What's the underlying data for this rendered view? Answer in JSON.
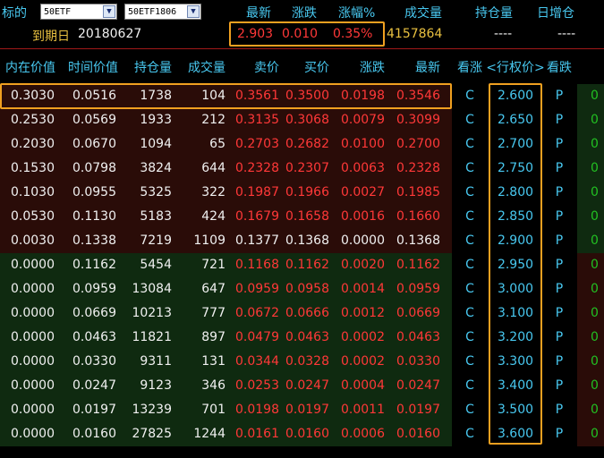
{
  "header": {
    "underlying_label": "标的",
    "underlying_value": "50ETF",
    "contract_value": "50ETF1806",
    "expiry_label": "到期日",
    "expiry_value": "20180627",
    "col_latest": "最新",
    "col_change": "涨跌",
    "col_change_pct": "涨幅%",
    "col_volume": "成交量",
    "col_open_interest": "持仓量",
    "col_daily_oi_change": "日增仓",
    "latest": "2.903",
    "change": "0.010",
    "change_pct": "0.35%",
    "volume": "4157864",
    "open_interest": "----",
    "daily_oi_change": "----"
  },
  "table": {
    "columns": [
      "内在价值",
      "时间价值",
      "持仓量",
      "成交量",
      "卖价",
      "买价",
      "涨跌",
      "最新",
      "看涨",
      "<行权价>",
      "看跌"
    ],
    "rows": [
      {
        "intrinsic": "0.3030",
        "time_value": "0.0516",
        "oi": "1738",
        "vol": "104",
        "ask": "0.3561",
        "bid": "0.3500",
        "chg": "0.0198",
        "last": "0.3546",
        "call": "C",
        "strike": "2.600",
        "put": "P",
        "side": "0"
      },
      {
        "intrinsic": "0.2530",
        "time_value": "0.0569",
        "oi": "1933",
        "vol": "212",
        "ask": "0.3135",
        "bid": "0.3068",
        "chg": "0.0079",
        "last": "0.3099",
        "call": "C",
        "strike": "2.650",
        "put": "P",
        "side": "0"
      },
      {
        "intrinsic": "0.2030",
        "time_value": "0.0670",
        "oi": "1094",
        "vol": "65",
        "ask": "0.2703",
        "bid": "0.2682",
        "chg": "0.0100",
        "last": "0.2700",
        "call": "C",
        "strike": "2.700",
        "put": "P",
        "side": "0"
      },
      {
        "intrinsic": "0.1530",
        "time_value": "0.0798",
        "oi": "3824",
        "vol": "644",
        "ask": "0.2328",
        "bid": "0.2307",
        "chg": "0.0063",
        "last": "0.2328",
        "call": "C",
        "strike": "2.750",
        "put": "P",
        "side": "0"
      },
      {
        "intrinsic": "0.1030",
        "time_value": "0.0955",
        "oi": "5325",
        "vol": "322",
        "ask": "0.1987",
        "bid": "0.1966",
        "chg": "0.0027",
        "last": "0.1985",
        "call": "C",
        "strike": "2.800",
        "put": "P",
        "side": "0"
      },
      {
        "intrinsic": "0.0530",
        "time_value": "0.1130",
        "oi": "5183",
        "vol": "424",
        "ask": "0.1679",
        "bid": "0.1658",
        "chg": "0.0016",
        "last": "0.1660",
        "call": "C",
        "strike": "2.850",
        "put": "P",
        "side": "0"
      },
      {
        "intrinsic": "0.0030",
        "time_value": "0.1338",
        "oi": "7219",
        "vol": "1109",
        "ask": "0.1377",
        "bid": "0.1368",
        "chg": "0.0000",
        "last": "0.1368",
        "call": "C",
        "strike": "2.900",
        "put": "P",
        "side": "0"
      },
      {
        "intrinsic": "0.0000",
        "time_value": "0.1162",
        "oi": "5454",
        "vol": "721",
        "ask": "0.1168",
        "bid": "0.1162",
        "chg": "0.0020",
        "last": "0.1162",
        "call": "C",
        "strike": "2.950",
        "put": "P",
        "side": "0"
      },
      {
        "intrinsic": "0.0000",
        "time_value": "0.0959",
        "oi": "13084",
        "vol": "647",
        "ask": "0.0959",
        "bid": "0.0958",
        "chg": "0.0014",
        "last": "0.0959",
        "call": "C",
        "strike": "3.000",
        "put": "P",
        "side": "0"
      },
      {
        "intrinsic": "0.0000",
        "time_value": "0.0669",
        "oi": "10213",
        "vol": "777",
        "ask": "0.0672",
        "bid": "0.0666",
        "chg": "0.0012",
        "last": "0.0669",
        "call": "C",
        "strike": "3.100",
        "put": "P",
        "side": "0"
      },
      {
        "intrinsic": "0.0000",
        "time_value": "0.0463",
        "oi": "11821",
        "vol": "897",
        "ask": "0.0479",
        "bid": "0.0463",
        "chg": "0.0002",
        "last": "0.0463",
        "call": "C",
        "strike": "3.200",
        "put": "P",
        "side": "0"
      },
      {
        "intrinsic": "0.0000",
        "time_value": "0.0330",
        "oi": "9311",
        "vol": "131",
        "ask": "0.0344",
        "bid": "0.0328",
        "chg": "0.0002",
        "last": "0.0330",
        "call": "C",
        "strike": "3.300",
        "put": "P",
        "side": "0"
      },
      {
        "intrinsic": "0.0000",
        "time_value": "0.0247",
        "oi": "9123",
        "vol": "346",
        "ask": "0.0253",
        "bid": "0.0247",
        "chg": "0.0004",
        "last": "0.0247",
        "call": "C",
        "strike": "3.400",
        "put": "P",
        "side": "0"
      },
      {
        "intrinsic": "0.0000",
        "time_value": "0.0197",
        "oi": "13239",
        "vol": "701",
        "ask": "0.0198",
        "bid": "0.0197",
        "chg": "0.0011",
        "last": "0.0197",
        "call": "C",
        "strike": "3.500",
        "put": "P",
        "side": "0"
      },
      {
        "intrinsic": "0.0000",
        "time_value": "0.0160",
        "oi": "27825",
        "vol": "1244",
        "ask": "0.0161",
        "bid": "0.0160",
        "chg": "0.0006",
        "last": "0.0160",
        "call": "C",
        "strike": "3.600",
        "put": "P",
        "side": "0"
      }
    ]
  },
  "colors": {
    "itm_row_bg": "#2a0c08",
    "otm_row_bg": "#0f2a10",
    "highlight_border": "#f0a020",
    "header_cyan": "#48c8f0",
    "price_up_red": "#ff3838",
    "text_yellow": "#e8c040",
    "side_green": "#22c022"
  }
}
